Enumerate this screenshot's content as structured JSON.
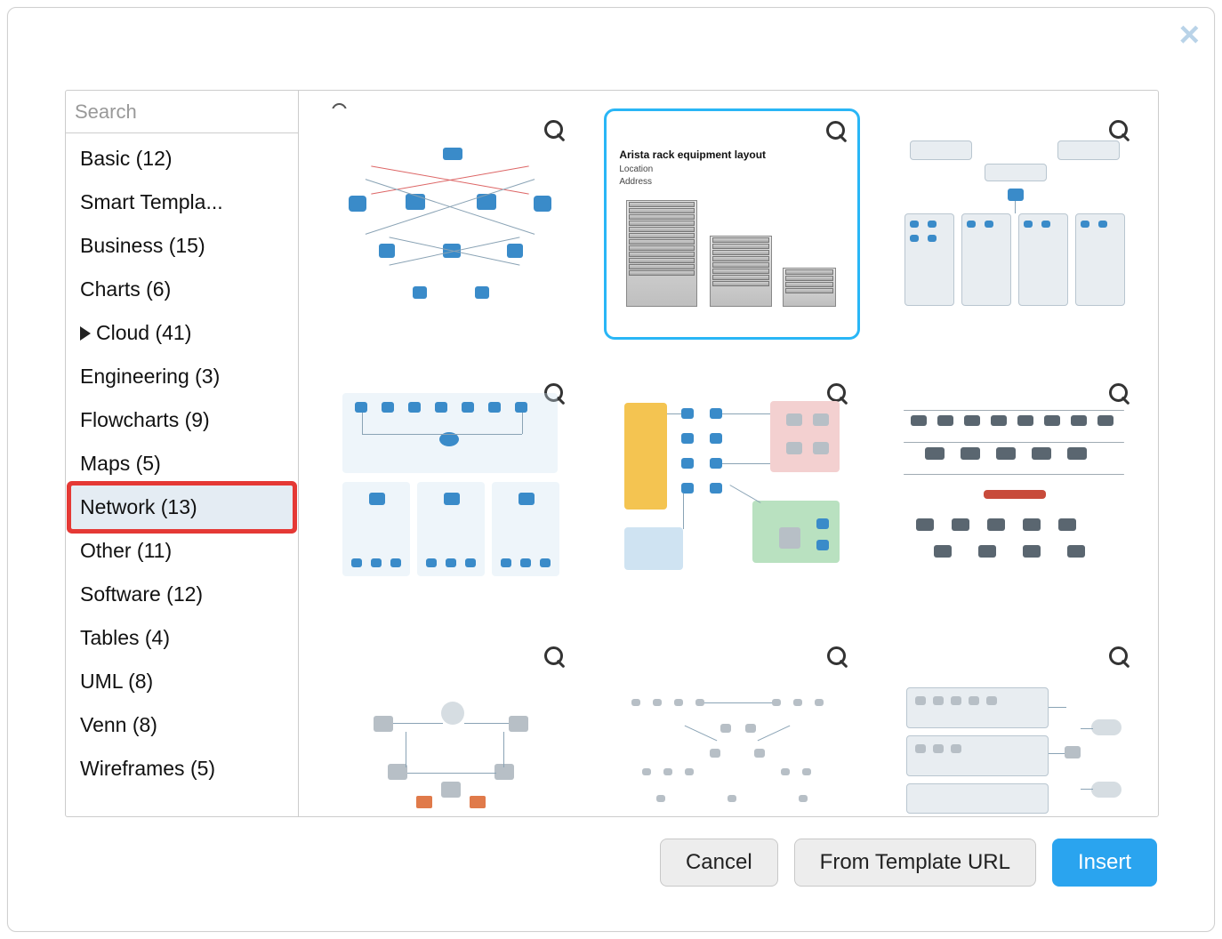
{
  "search": {
    "placeholder": "Search"
  },
  "sidebar": {
    "items": [
      {
        "label": "Basic (12)"
      },
      {
        "label": "Smart Templa..."
      },
      {
        "label": "Business (15)"
      },
      {
        "label": "Charts (6)"
      },
      {
        "label": "Cloud (41)",
        "expandable": true
      },
      {
        "label": "Engineering (3)"
      },
      {
        "label": "Flowcharts (9)"
      },
      {
        "label": "Maps (5)"
      },
      {
        "label": "Network (13)",
        "selected": true,
        "highlight": true
      },
      {
        "label": "Other (11)"
      },
      {
        "label": "Software (12)"
      },
      {
        "label": "Tables (4)"
      },
      {
        "label": "UML (8)"
      },
      {
        "label": "Venn (8)"
      },
      {
        "label": "Wireframes (5)"
      }
    ]
  },
  "rack_card": {
    "title": "Arista rack equipment layout",
    "line1": "Location",
    "line2": "Address"
  },
  "footer": {
    "cancel": "Cancel",
    "from_url": "From Template URL",
    "insert": "Insert"
  }
}
